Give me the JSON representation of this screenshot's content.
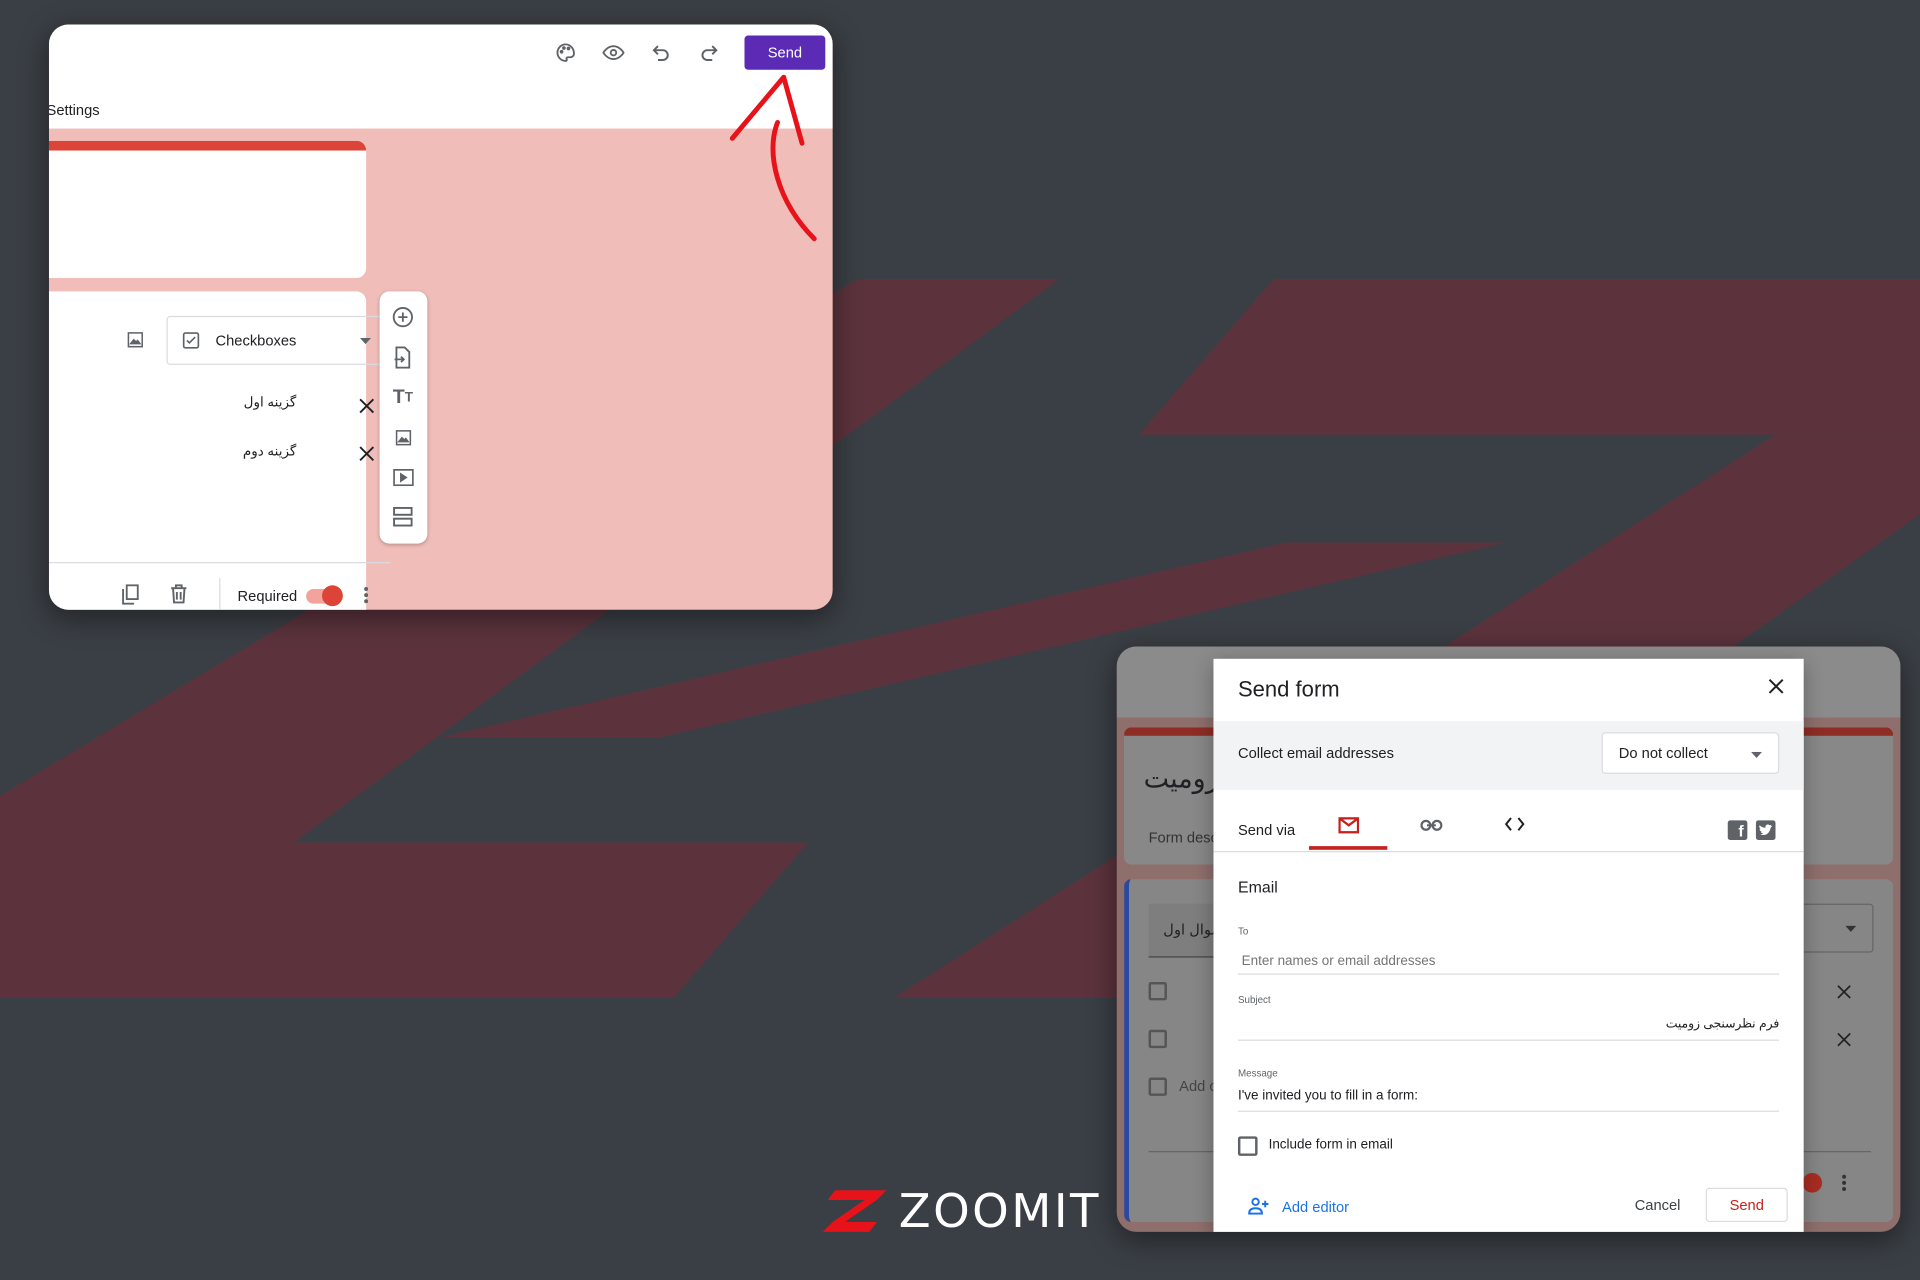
{
  "colors": {
    "background": "#3a3f45",
    "stripes": "#5c333d",
    "accent_purple": "#5b2bb5",
    "form_theme": "#db4437",
    "pink_bg": "#f0bdb8",
    "dialog_red": "#c5221f",
    "link_blue": "#1a73e8"
  },
  "editor": {
    "toolbar": {
      "icons": [
        "palette-icon",
        "eye-icon",
        "undo-icon",
        "redo-icon"
      ],
      "send_label": "Send"
    },
    "tab_settings": "Settings",
    "question": {
      "type_label": "Checkboxes",
      "options": [
        "گزینه اول",
        "گزینه دوم"
      ],
      "required_label": "Required",
      "required_on": true
    },
    "side_toolbar": [
      "add-question-icon",
      "import-questions-icon",
      "title-text-icon",
      "image-icon",
      "video-icon",
      "section-icon"
    ]
  },
  "background_form": {
    "title_partial": "رومیت",
    "description_partial": "Form desc",
    "question_partial": "سوال اول",
    "add_option_partial": "Add c"
  },
  "send_dialog": {
    "title": "Send form",
    "collect_label": "Collect email addresses",
    "collect_value": "Do not collect",
    "send_via_label": "Send via",
    "tabs": [
      "email-icon",
      "link-icon",
      "embed-icon"
    ],
    "active_tab": "email-icon",
    "section_heading": "Email",
    "to": {
      "label": "To",
      "placeholder": "Enter names or email addresses",
      "value": ""
    },
    "subject": {
      "label": "Subject",
      "value": "فرم نظرسنجی زومیت"
    },
    "message": {
      "label": "Message",
      "value": "I've invited you to fill in a form:"
    },
    "include_form_label": "Include form in email",
    "include_form_checked": false,
    "add_editor_label": "Add editor",
    "cancel_label": "Cancel",
    "send_label": "Send"
  },
  "logo": {
    "text": "ZOOMIT"
  }
}
